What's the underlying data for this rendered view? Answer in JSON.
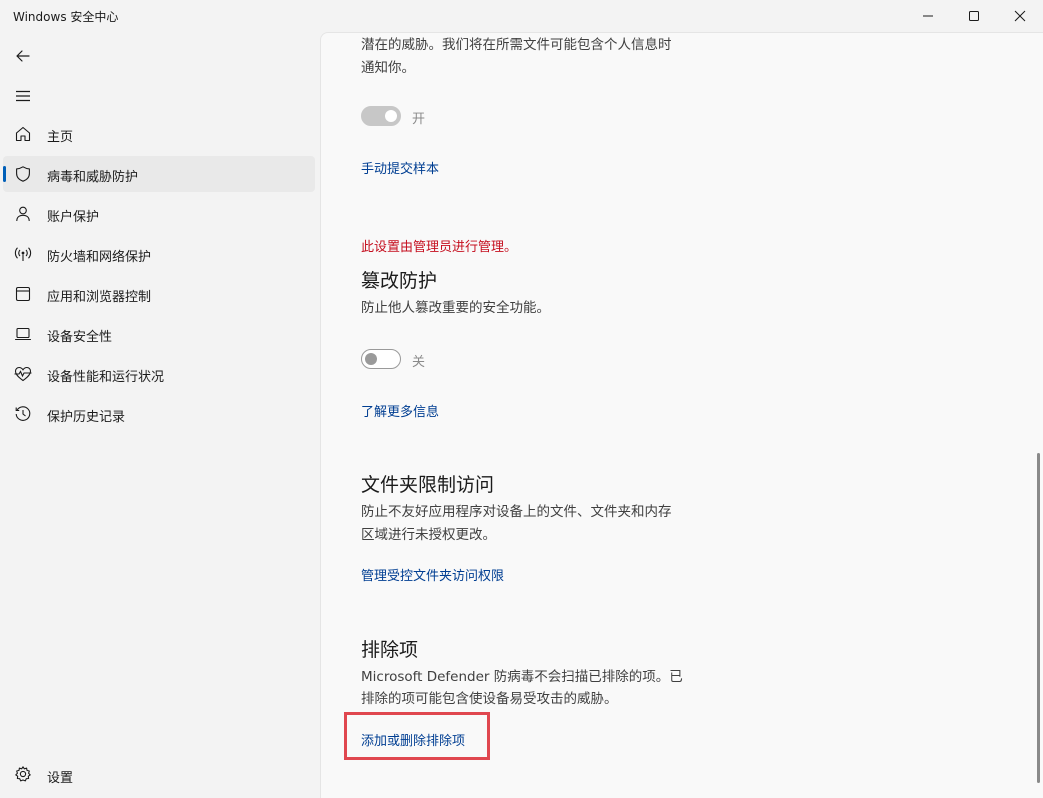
{
  "window": {
    "title": "Windows 安全中心"
  },
  "sidebar": {
    "items": [
      {
        "label": "主页",
        "icon": "home-icon"
      },
      {
        "label": "病毒和威胁防护",
        "icon": "shield-icon",
        "active": true
      },
      {
        "label": "账户保护",
        "icon": "person-icon"
      },
      {
        "label": "防火墙和网络保护",
        "icon": "wireless-icon"
      },
      {
        "label": "应用和浏览器控制",
        "icon": "app-window-icon"
      },
      {
        "label": "设备安全性",
        "icon": "laptop-icon"
      },
      {
        "label": "设备性能和运行状况",
        "icon": "heart-pulse-icon"
      },
      {
        "label": "保护历史记录",
        "icon": "history-icon"
      }
    ],
    "settings_label": "设置"
  },
  "content": {
    "sample": {
      "desc_line1": "潜在的威胁。我们将在所需文件可能包含个人信息时",
      "desc_line2": "通知你。",
      "toggle_state": "开",
      "link": "手动提交样本"
    },
    "tamper": {
      "admin_notice": "此设置由管理员进行管理。",
      "heading": "篡改防护",
      "desc": "防止他人篡改重要的安全功能。",
      "toggle_state": "关",
      "link": "了解更多信息"
    },
    "folder_access": {
      "heading": "文件夹限制访问",
      "desc_line1": "防止不友好应用程序对设备上的文件、文件夹和内存",
      "desc_line2": "区域进行未授权更改。",
      "link": "管理受控文件夹访问权限"
    },
    "exclusions": {
      "heading": "排除项",
      "desc_line1": "Microsoft Defender 防病毒不会扫描已排除的项。已",
      "desc_line2": "排除的项可能包含使设备易受攻击的威胁。",
      "link": "添加或删除排除项"
    }
  },
  "colors": {
    "accent": "#005fb8",
    "link": "#003e92",
    "warning": "#c50f1f",
    "highlight": "#e0474f"
  }
}
